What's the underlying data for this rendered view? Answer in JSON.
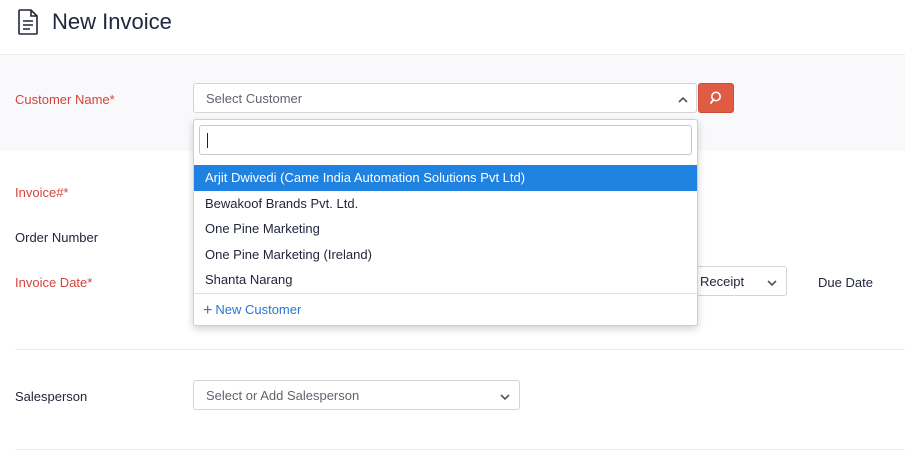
{
  "header": {
    "title": "New Invoice",
    "icon": "document-icon"
  },
  "form": {
    "customer_label": "Customer Name*",
    "customer_placeholder": "Select Customer",
    "invoice_label": "Invoice#*",
    "order_label": "Order Number",
    "invoice_date_label": "Invoice Date*",
    "terms_value": "Receipt",
    "due_date_label": "Due Date",
    "salesperson_label": "Salesperson",
    "salesperson_placeholder": "Select or Add Salesperson"
  },
  "dropdown": {
    "search_value": "",
    "items": [
      "Arjit Dwivedi (Came India Automation Solutions Pvt Ltd)",
      "Bewakoof Brands Pvt. Ltd.",
      "One Pine Marketing",
      "One Pine Marketing (Ireland)",
      "Shanta Narang"
    ],
    "new_customer_label": "New Customer"
  },
  "colors": {
    "required": "#d6433b",
    "accent_button": "#e05b44",
    "highlight": "#1f82e0",
    "link": "#2a75d6"
  }
}
